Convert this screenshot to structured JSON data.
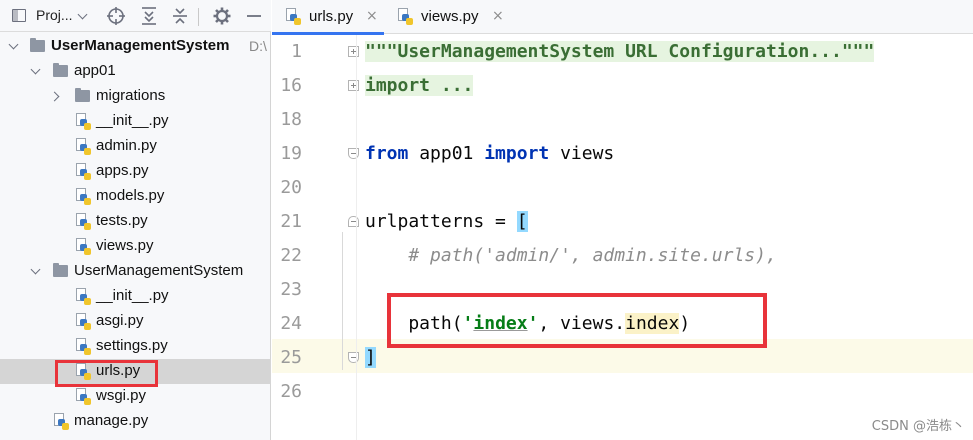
{
  "project_panel": {
    "title": "Proj...",
    "toolbar_icons": [
      "target-icon",
      "expand-all-icon",
      "collapse-all-icon",
      "gear-icon",
      "hide-icon"
    ]
  },
  "tree": [
    {
      "label": "UserManagementSystem",
      "path": "D:\\",
      "level": 0,
      "kind": "folder",
      "expanded": true
    },
    {
      "label": "app01",
      "level": 1,
      "kind": "folder",
      "expanded": true
    },
    {
      "label": "migrations",
      "level": 2,
      "kind": "folder",
      "expanded": false
    },
    {
      "label": "__init__.py",
      "level": 2,
      "kind": "py"
    },
    {
      "label": "admin.py",
      "level": 2,
      "kind": "py"
    },
    {
      "label": "apps.py",
      "level": 2,
      "kind": "py"
    },
    {
      "label": "models.py",
      "level": 2,
      "kind": "py"
    },
    {
      "label": "tests.py",
      "level": 2,
      "kind": "py"
    },
    {
      "label": "views.py",
      "level": 2,
      "kind": "py"
    },
    {
      "label": "UserManagementSystem",
      "level": 1,
      "kind": "folder",
      "expanded": true
    },
    {
      "label": "__init__.py",
      "level": 2,
      "kind": "py"
    },
    {
      "label": "asgi.py",
      "level": 2,
      "kind": "py"
    },
    {
      "label": "settings.py",
      "level": 2,
      "kind": "py"
    },
    {
      "label": "urls.py",
      "level": 2,
      "kind": "py",
      "selected": true
    },
    {
      "label": "wsgi.py",
      "level": 2,
      "kind": "py"
    },
    {
      "label": "manage.py",
      "level": 1,
      "kind": "py"
    }
  ],
  "tabs": [
    {
      "label": "urls.py",
      "close": "×",
      "active": true
    },
    {
      "label": "views.py",
      "close": "×",
      "active": false
    }
  ],
  "editor": {
    "line_numbers": [
      "1",
      "16",
      "18",
      "19",
      "20",
      "21",
      "22",
      "23",
      "24",
      "25",
      "26"
    ],
    "line1_docstring": "\"\"\"UserManagementSystem URL Configuration...\"\"\"",
    "line16_folded_import": "import ...",
    "line19": {
      "kw_from": "from",
      "module": " app01 ",
      "kw_import": "import",
      "name": " views"
    },
    "line21": {
      "name": "urlpatterns = ",
      "bracket": "["
    },
    "line22_comment": "    # path('admin/', admin.site.urls),",
    "line24": {
      "indent": "    path(",
      "quote_open": "'",
      "route": "index",
      "quote_close": "'",
      "mid": ", views.",
      "func": "index",
      "close": ")"
    },
    "line25_bracket": "]"
  },
  "watermark": "CSDN @浩栋丶",
  "colors": {
    "highlight_box": "#e8333a",
    "keyword": "#0033b3",
    "string": "#067d17",
    "selection": "#d5d5d5",
    "tab_accent": "#3574f0"
  }
}
